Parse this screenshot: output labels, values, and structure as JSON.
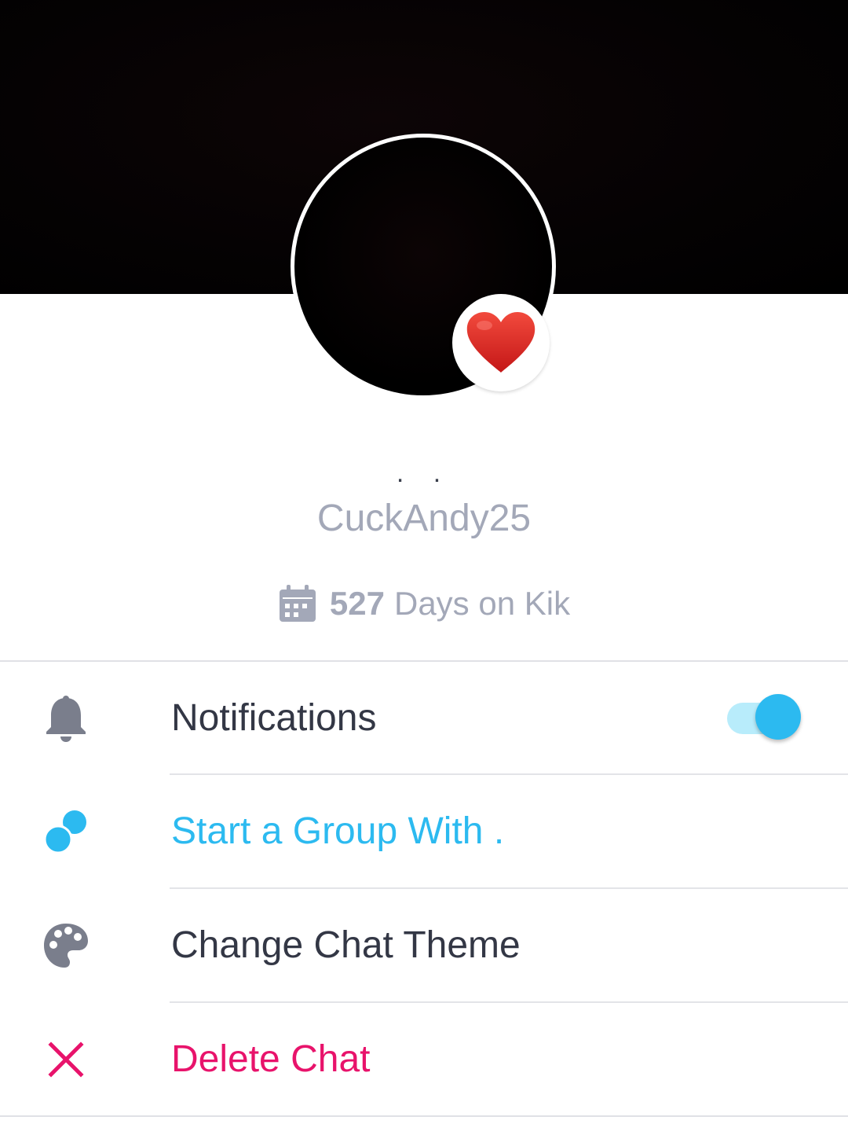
{
  "profile": {
    "status_dots": ". .",
    "username": "CuckAndy25",
    "days_count": "527",
    "days_label": "Days on Kik",
    "badge_icon": "heart-icon"
  },
  "menu": {
    "notifications": {
      "label": "Notifications",
      "toggle_on": true,
      "icon": "bell-icon"
    },
    "start_group": {
      "label": "Start a Group With .",
      "icon": "group-icon"
    },
    "change_theme": {
      "label": "Change Chat Theme",
      "icon": "palette-icon"
    },
    "delete_chat": {
      "label": "Delete Chat",
      "icon": "close-icon"
    }
  },
  "colors": {
    "accent_blue": "#2cbaf0",
    "delete_pink": "#e8136b",
    "muted_text": "#a3a8b8",
    "dark_text": "#333745",
    "icon_gray": "#7a7e8c"
  }
}
